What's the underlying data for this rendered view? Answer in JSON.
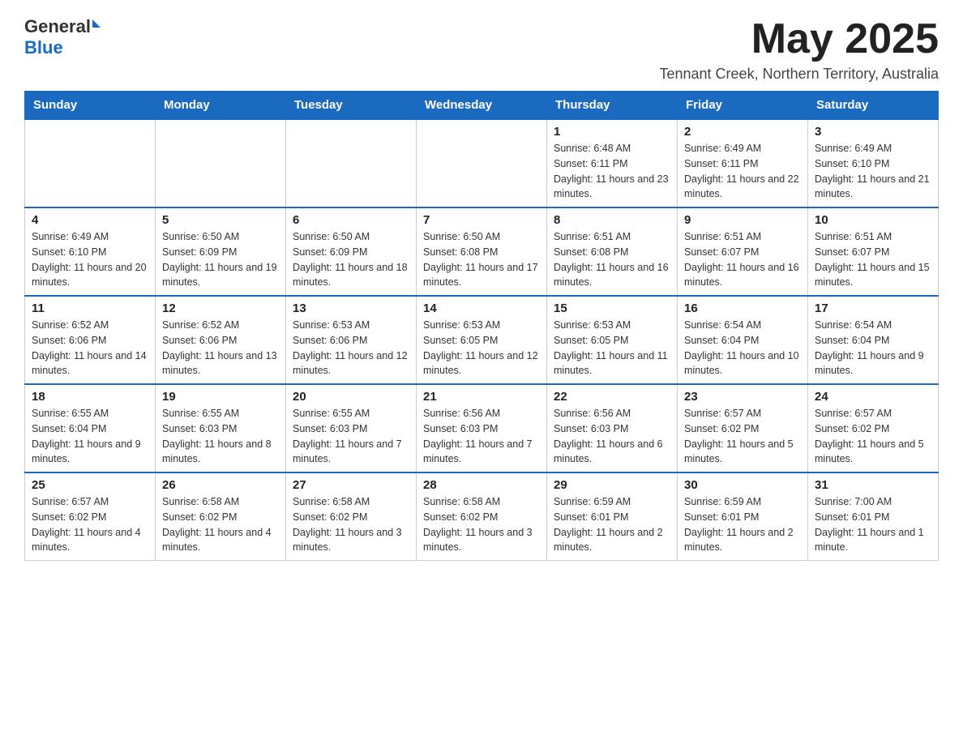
{
  "header": {
    "logo": {
      "general": "General",
      "blue": "Blue"
    },
    "title": "May 2025",
    "location": "Tennant Creek, Northern Territory, Australia"
  },
  "days_of_week": [
    "Sunday",
    "Monday",
    "Tuesday",
    "Wednesday",
    "Thursday",
    "Friday",
    "Saturday"
  ],
  "weeks": [
    [
      {
        "day": "",
        "info": ""
      },
      {
        "day": "",
        "info": ""
      },
      {
        "day": "",
        "info": ""
      },
      {
        "day": "",
        "info": ""
      },
      {
        "day": "1",
        "info": "Sunrise: 6:48 AM\nSunset: 6:11 PM\nDaylight: 11 hours and 23 minutes."
      },
      {
        "day": "2",
        "info": "Sunrise: 6:49 AM\nSunset: 6:11 PM\nDaylight: 11 hours and 22 minutes."
      },
      {
        "day": "3",
        "info": "Sunrise: 6:49 AM\nSunset: 6:10 PM\nDaylight: 11 hours and 21 minutes."
      }
    ],
    [
      {
        "day": "4",
        "info": "Sunrise: 6:49 AM\nSunset: 6:10 PM\nDaylight: 11 hours and 20 minutes."
      },
      {
        "day": "5",
        "info": "Sunrise: 6:50 AM\nSunset: 6:09 PM\nDaylight: 11 hours and 19 minutes."
      },
      {
        "day": "6",
        "info": "Sunrise: 6:50 AM\nSunset: 6:09 PM\nDaylight: 11 hours and 18 minutes."
      },
      {
        "day": "7",
        "info": "Sunrise: 6:50 AM\nSunset: 6:08 PM\nDaylight: 11 hours and 17 minutes."
      },
      {
        "day": "8",
        "info": "Sunrise: 6:51 AM\nSunset: 6:08 PM\nDaylight: 11 hours and 16 minutes."
      },
      {
        "day": "9",
        "info": "Sunrise: 6:51 AM\nSunset: 6:07 PM\nDaylight: 11 hours and 16 minutes."
      },
      {
        "day": "10",
        "info": "Sunrise: 6:51 AM\nSunset: 6:07 PM\nDaylight: 11 hours and 15 minutes."
      }
    ],
    [
      {
        "day": "11",
        "info": "Sunrise: 6:52 AM\nSunset: 6:06 PM\nDaylight: 11 hours and 14 minutes."
      },
      {
        "day": "12",
        "info": "Sunrise: 6:52 AM\nSunset: 6:06 PM\nDaylight: 11 hours and 13 minutes."
      },
      {
        "day": "13",
        "info": "Sunrise: 6:53 AM\nSunset: 6:06 PM\nDaylight: 11 hours and 12 minutes."
      },
      {
        "day": "14",
        "info": "Sunrise: 6:53 AM\nSunset: 6:05 PM\nDaylight: 11 hours and 12 minutes."
      },
      {
        "day": "15",
        "info": "Sunrise: 6:53 AM\nSunset: 6:05 PM\nDaylight: 11 hours and 11 minutes."
      },
      {
        "day": "16",
        "info": "Sunrise: 6:54 AM\nSunset: 6:04 PM\nDaylight: 11 hours and 10 minutes."
      },
      {
        "day": "17",
        "info": "Sunrise: 6:54 AM\nSunset: 6:04 PM\nDaylight: 11 hours and 9 minutes."
      }
    ],
    [
      {
        "day": "18",
        "info": "Sunrise: 6:55 AM\nSunset: 6:04 PM\nDaylight: 11 hours and 9 minutes."
      },
      {
        "day": "19",
        "info": "Sunrise: 6:55 AM\nSunset: 6:03 PM\nDaylight: 11 hours and 8 minutes."
      },
      {
        "day": "20",
        "info": "Sunrise: 6:55 AM\nSunset: 6:03 PM\nDaylight: 11 hours and 7 minutes."
      },
      {
        "day": "21",
        "info": "Sunrise: 6:56 AM\nSunset: 6:03 PM\nDaylight: 11 hours and 7 minutes."
      },
      {
        "day": "22",
        "info": "Sunrise: 6:56 AM\nSunset: 6:03 PM\nDaylight: 11 hours and 6 minutes."
      },
      {
        "day": "23",
        "info": "Sunrise: 6:57 AM\nSunset: 6:02 PM\nDaylight: 11 hours and 5 minutes."
      },
      {
        "day": "24",
        "info": "Sunrise: 6:57 AM\nSunset: 6:02 PM\nDaylight: 11 hours and 5 minutes."
      }
    ],
    [
      {
        "day": "25",
        "info": "Sunrise: 6:57 AM\nSunset: 6:02 PM\nDaylight: 11 hours and 4 minutes."
      },
      {
        "day": "26",
        "info": "Sunrise: 6:58 AM\nSunset: 6:02 PM\nDaylight: 11 hours and 4 minutes."
      },
      {
        "day": "27",
        "info": "Sunrise: 6:58 AM\nSunset: 6:02 PM\nDaylight: 11 hours and 3 minutes."
      },
      {
        "day": "28",
        "info": "Sunrise: 6:58 AM\nSunset: 6:02 PM\nDaylight: 11 hours and 3 minutes."
      },
      {
        "day": "29",
        "info": "Sunrise: 6:59 AM\nSunset: 6:01 PM\nDaylight: 11 hours and 2 minutes."
      },
      {
        "day": "30",
        "info": "Sunrise: 6:59 AM\nSunset: 6:01 PM\nDaylight: 11 hours and 2 minutes."
      },
      {
        "day": "31",
        "info": "Sunrise: 7:00 AM\nSunset: 6:01 PM\nDaylight: 11 hours and 1 minute."
      }
    ]
  ]
}
